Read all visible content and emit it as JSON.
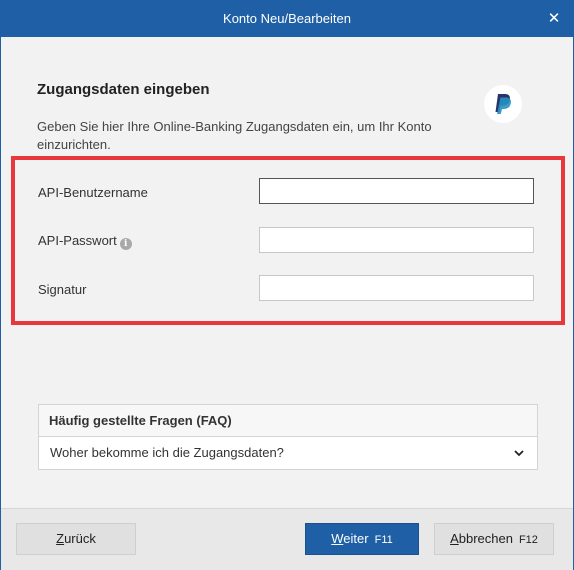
{
  "window": {
    "title": "Konto Neu/Bearbeiten",
    "close_glyph": "✕"
  },
  "page": {
    "heading": "Zugangsdaten eingeben",
    "description": "Geben Sie hier Ihre Online-Banking Zugangsdaten ein, um Ihr Konto einzurichten.",
    "logo_icon": "paypal-logo",
    "highlight_color": "#e8383e"
  },
  "form": {
    "fields": [
      {
        "label": "API-Benutzername",
        "value": "",
        "focused": true
      },
      {
        "label": "API-Passwort",
        "value": "",
        "has_info": true,
        "info_glyph": "i"
      },
      {
        "label": "Signatur",
        "value": ""
      }
    ]
  },
  "faq": {
    "header": "Häufig gestellte Fragen (FAQ)",
    "items": [
      {
        "question": "Woher bekomme ich die Zugangsdaten?"
      }
    ]
  },
  "footer": {
    "back": {
      "accel": "Z",
      "rest": "urück"
    },
    "next": {
      "accel": "W",
      "rest": "eiter",
      "key": "F11"
    },
    "cancel": {
      "accel": "A",
      "rest": "bbrechen",
      "key": "F12"
    }
  },
  "colors": {
    "accent": "#1f5fa6",
    "highlight": "#e8383e",
    "background": "#f2f2f2"
  }
}
